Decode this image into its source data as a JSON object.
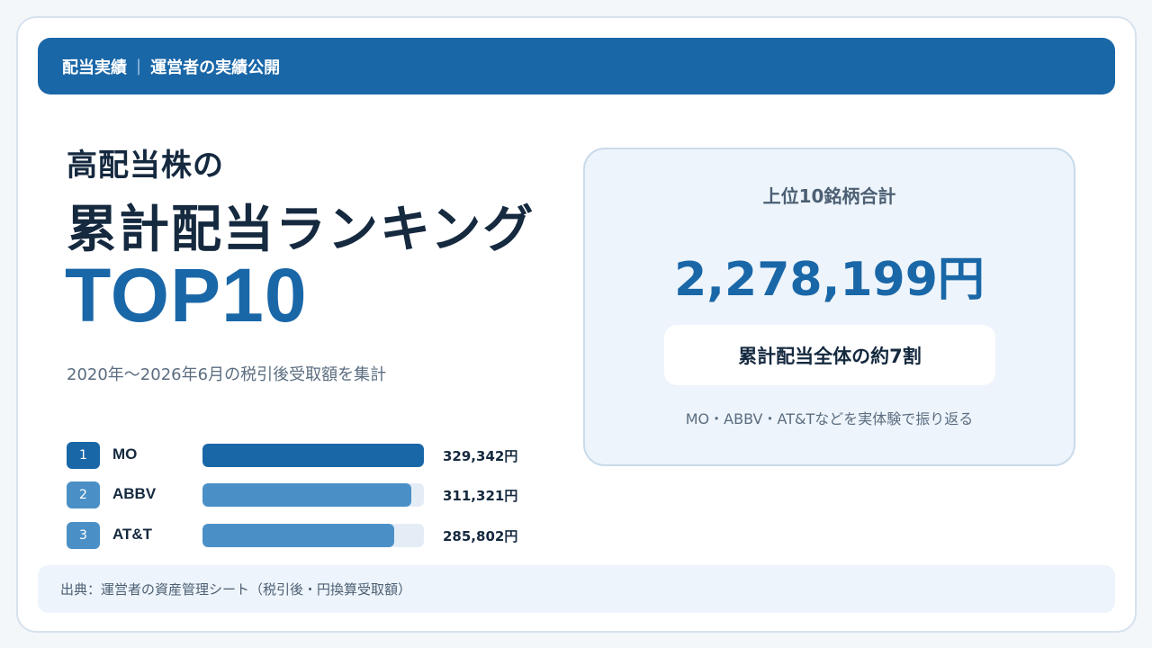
{
  "header": {
    "section": "配当実績",
    "separator": "|",
    "subtitle": "運営者の実績公開"
  },
  "title": {
    "line1": "高配当株の",
    "line2": "累計配当ランキング",
    "line3": "TOP10"
  },
  "period_note": "2020年〜2026年6月の税引後受取額を集計",
  "ranking": [
    {
      "rank": "1",
      "name": "MO",
      "value": "329,342円",
      "amount": 329342,
      "color": "#1a67a8"
    },
    {
      "rank": "2",
      "name": "ABBV",
      "value": "311,321円",
      "amount": 311321,
      "color": "#4a90c6"
    },
    {
      "rank": "3",
      "name": "AT&T",
      "value": "285,802円",
      "amount": 285802,
      "color": "#4a90c6"
    }
  ],
  "summary": {
    "label": "上位10銘柄合計",
    "total": "2,278,199円",
    "highlight": "累計配当全体の約7割",
    "note": "MO・ABBV・AT&Tなどを実体験で振り返る"
  },
  "footer": {
    "source": "出典：運営者の資産管理シート（税引後・円換算受取額）"
  }
}
